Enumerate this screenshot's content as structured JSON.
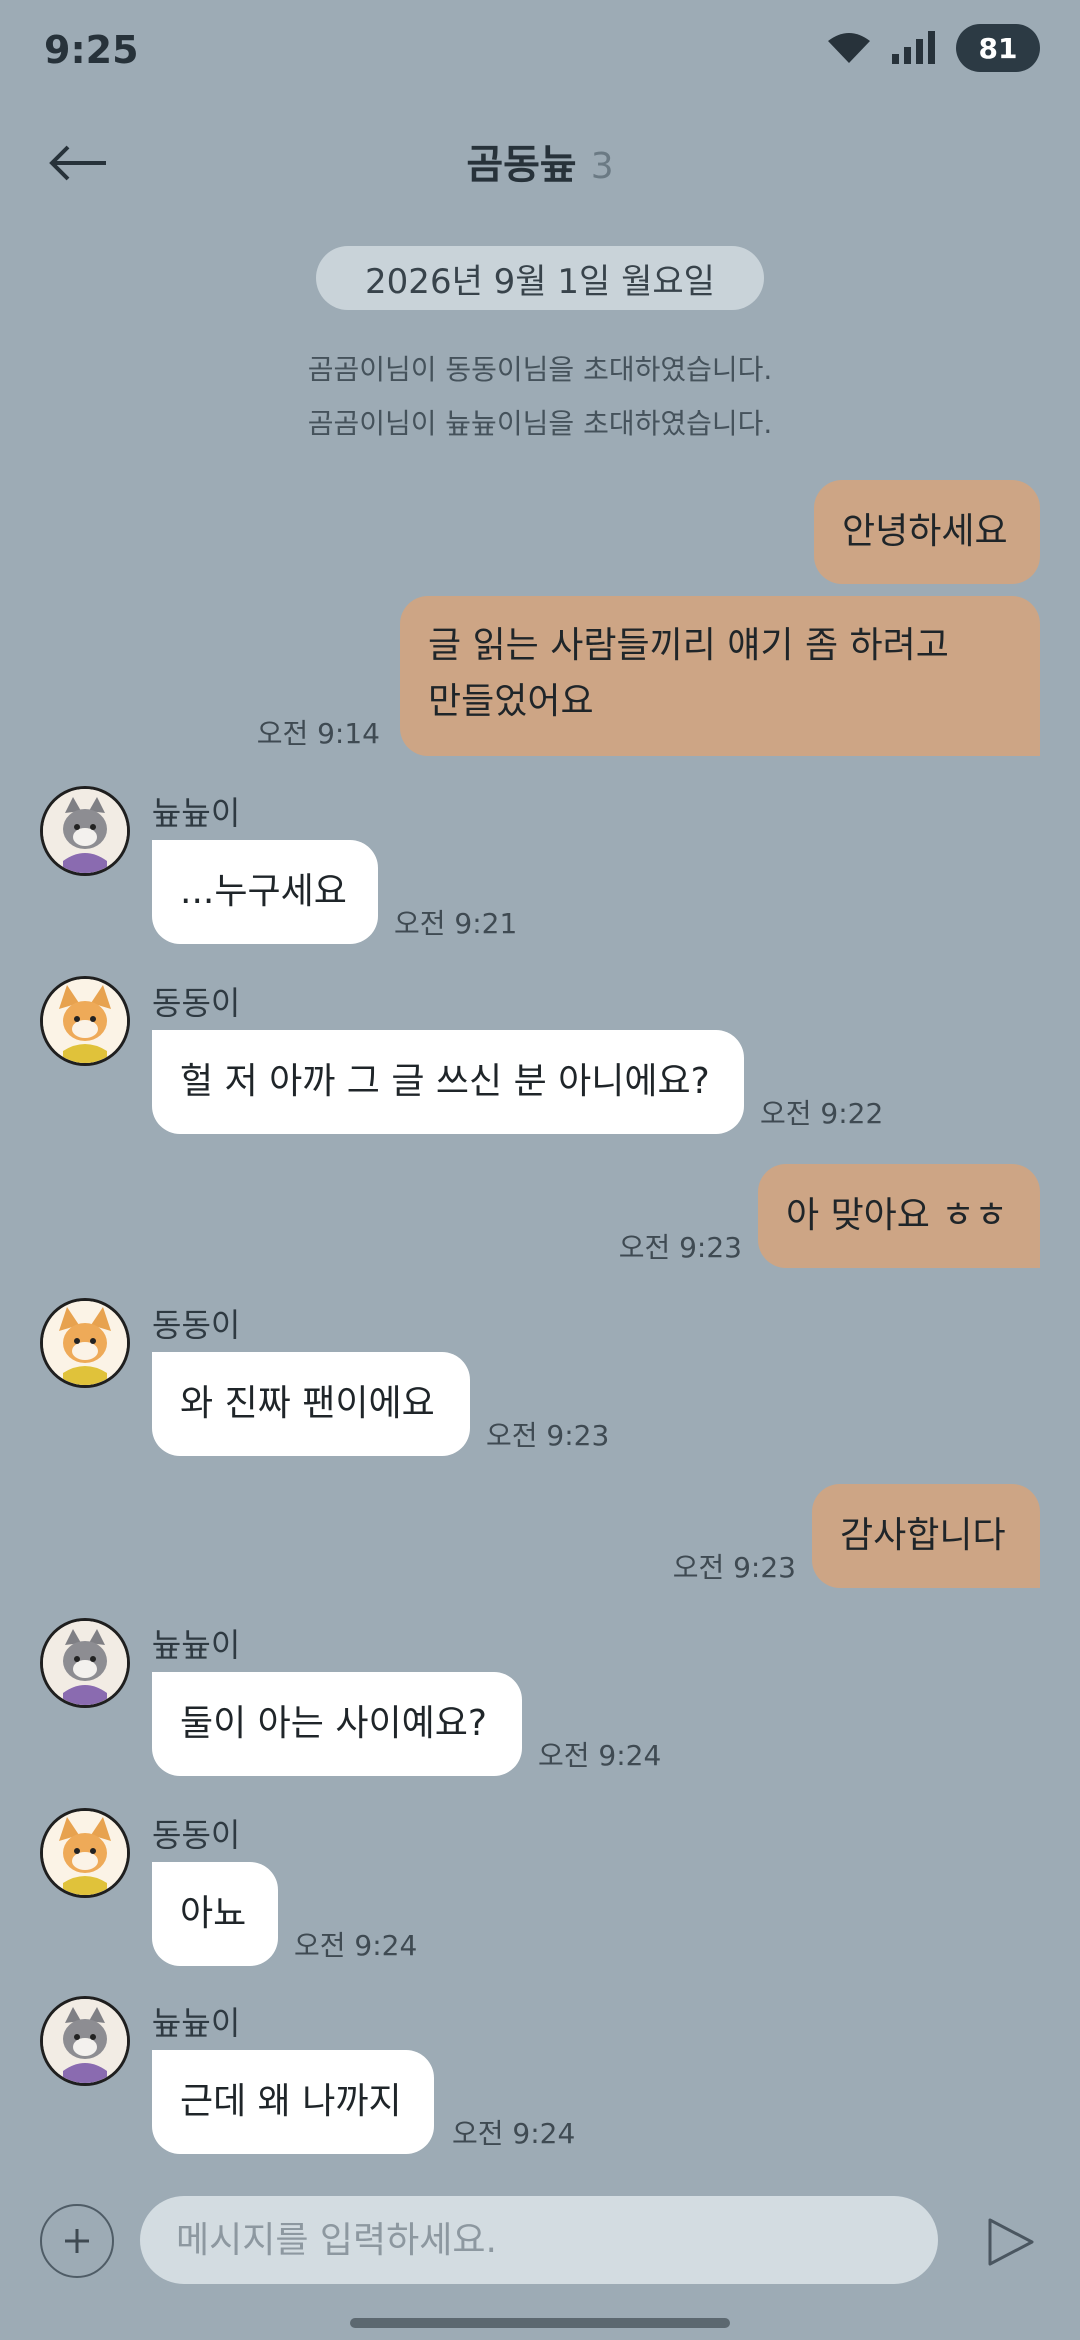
{
  "status_bar": {
    "time": "9:25",
    "battery": "81",
    "wifi_icon": "wifi-icon",
    "signal_icon": "signal-icon"
  },
  "header": {
    "title": "곰동늎",
    "member_count": "3",
    "back_icon": "back-arrow-icon"
  },
  "date_chip": "2026년 9월 1일 월요일",
  "system_messages": [
    "곰곰이님이 동동이님을 초대하였습니다.",
    "곰곰이님이 늎늎이님을 초대하였습니다."
  ],
  "messages": [
    {
      "sender": "me",
      "text": "안녕하세요",
      "time": ""
    },
    {
      "sender": "me",
      "text_lines": [
        "글 읽는 사람들끼리 얘기 좀 하려고",
        "만들었어요"
      ],
      "time": "오전 9:14"
    },
    {
      "sender": "늎늎이",
      "text": "...누구세요",
      "time": "오전 9:21",
      "avatar": "cat-avatar-icon"
    },
    {
      "sender": "동동이",
      "text": "헐 저 아까 그 글 쓰신 분 아니에요?",
      "time": "오전 9:22",
      "avatar": "dog-avatar-icon"
    },
    {
      "sender": "me",
      "text": "아 맞아요 ㅎㅎ",
      "time": "오전 9:23"
    },
    {
      "sender": "동동이",
      "text": "와 진짜 팬이에요",
      "time": "오전 9:23",
      "avatar": "dog-avatar-icon"
    },
    {
      "sender": "me",
      "text": "감사합니다",
      "time": "오전 9:23"
    },
    {
      "sender": "늎늎이",
      "text": "둘이 아는 사이예요?",
      "time": "오전 9:24",
      "avatar": "cat-avatar-icon"
    },
    {
      "sender": "동동이",
      "text": "아뇨",
      "time": "오전 9:24",
      "avatar": "dog-avatar-icon"
    },
    {
      "sender": "늎늎이",
      "text": "근데 왜 나까지",
      "time": "오전 9:24",
      "avatar": "cat-avatar-icon"
    }
  ],
  "composer": {
    "placeholder": "메시지를 입력하세요.",
    "plus_icon": "plus-icon",
    "send_icon": "send-icon"
  },
  "colors": {
    "background": "#9dabb5",
    "my_bubble": "#cda585",
    "other_bubble": "#ffffff",
    "date_chip": "#c9d3d9"
  }
}
